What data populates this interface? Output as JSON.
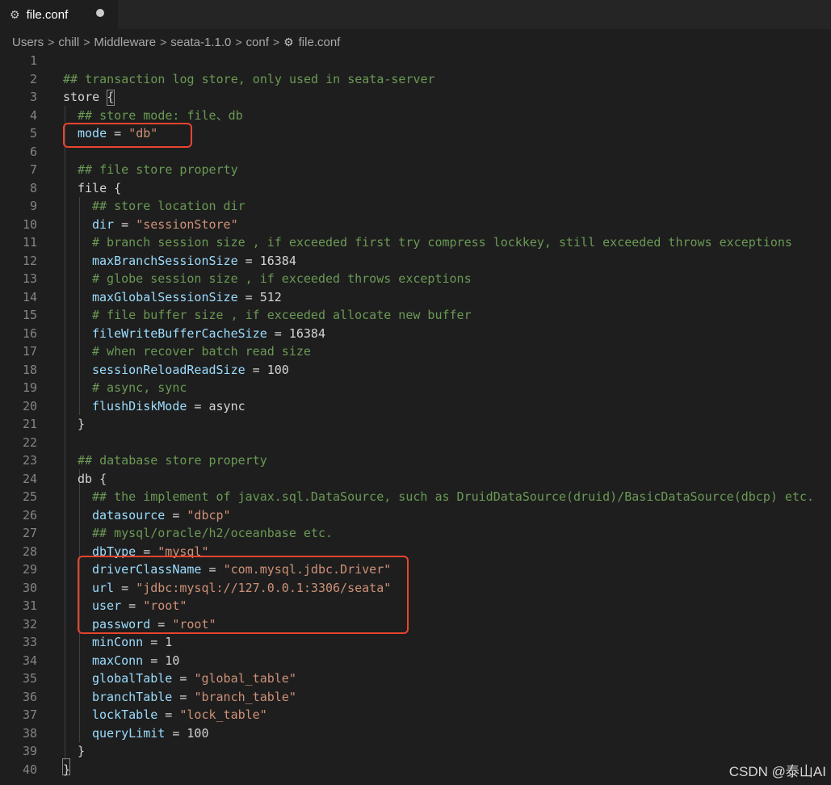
{
  "tab": {
    "title": "file.conf",
    "icon": "gear-icon",
    "modified": true
  },
  "breadcrumb": [
    "Users",
    "chill",
    "Middleware",
    "seata-1.1.0",
    "conf",
    "file.conf"
  ],
  "watermark": "CSDN @泰山AI",
  "colors": {
    "highlight": "#e8442e",
    "comment": "#6a9955",
    "key": "#9cdcfe",
    "string": "#ce9178"
  },
  "lines": [
    {
      "n": "1",
      "indent": 0,
      "tokens": []
    },
    {
      "n": "2",
      "indent": 0,
      "tokens": [
        {
          "t": "## transaction log store, only used in seata-server",
          "c": "comment"
        }
      ]
    },
    {
      "n": "3",
      "indent": 0,
      "tokens": [
        {
          "t": "store ",
          "c": "plain"
        },
        {
          "t": "{",
          "c": "plain"
        }
      ]
    },
    {
      "n": "4",
      "indent": 1,
      "tokens": [
        {
          "t": "## store mode: file、db",
          "c": "comment"
        }
      ]
    },
    {
      "n": "5",
      "indent": 1,
      "tokens": [
        {
          "t": "mode",
          "c": "key"
        },
        {
          "t": " = ",
          "c": "plain"
        },
        {
          "t": "\"db\"",
          "c": "str"
        }
      ]
    },
    {
      "n": "6",
      "indent": 0,
      "tokens": []
    },
    {
      "n": "7",
      "indent": 1,
      "tokens": [
        {
          "t": "## file store property",
          "c": "comment"
        }
      ]
    },
    {
      "n": "8",
      "indent": 1,
      "tokens": [
        {
          "t": "file {",
          "c": "plain"
        }
      ]
    },
    {
      "n": "9",
      "indent": 2,
      "tokens": [
        {
          "t": "## store location dir",
          "c": "comment"
        }
      ]
    },
    {
      "n": "10",
      "indent": 2,
      "tokens": [
        {
          "t": "dir",
          "c": "key"
        },
        {
          "t": " = ",
          "c": "plain"
        },
        {
          "t": "\"sessionStore\"",
          "c": "str"
        }
      ]
    },
    {
      "n": "11",
      "indent": 2,
      "tokens": [
        {
          "t": "# branch session size , if exceeded first try compress lockkey, still exceeded throws exceptions",
          "c": "comment"
        }
      ]
    },
    {
      "n": "12",
      "indent": 2,
      "tokens": [
        {
          "t": "maxBranchSessionSize",
          "c": "key"
        },
        {
          "t": " = 16384",
          "c": "plain"
        }
      ]
    },
    {
      "n": "13",
      "indent": 2,
      "tokens": [
        {
          "t": "# globe session size , if exceeded throws exceptions",
          "c": "comment"
        }
      ]
    },
    {
      "n": "14",
      "indent": 2,
      "tokens": [
        {
          "t": "maxGlobalSessionSize",
          "c": "key"
        },
        {
          "t": " = 512",
          "c": "plain"
        }
      ]
    },
    {
      "n": "15",
      "indent": 2,
      "tokens": [
        {
          "t": "# file buffer size , if exceeded allocate new buffer",
          "c": "comment"
        }
      ]
    },
    {
      "n": "16",
      "indent": 2,
      "tokens": [
        {
          "t": "fileWriteBufferCacheSize",
          "c": "key"
        },
        {
          "t": " = 16384",
          "c": "plain"
        }
      ]
    },
    {
      "n": "17",
      "indent": 2,
      "tokens": [
        {
          "t": "# when recover batch read size",
          "c": "comment"
        }
      ]
    },
    {
      "n": "18",
      "indent": 2,
      "tokens": [
        {
          "t": "sessionReloadReadSize",
          "c": "key"
        },
        {
          "t": " = 100",
          "c": "plain"
        }
      ]
    },
    {
      "n": "19",
      "indent": 2,
      "tokens": [
        {
          "t": "# async, sync",
          "c": "comment"
        }
      ]
    },
    {
      "n": "20",
      "indent": 2,
      "tokens": [
        {
          "t": "flushDiskMode",
          "c": "key"
        },
        {
          "t": " = async",
          "c": "plain"
        }
      ]
    },
    {
      "n": "21",
      "indent": 1,
      "tokens": [
        {
          "t": "}",
          "c": "plain"
        }
      ]
    },
    {
      "n": "22",
      "indent": 0,
      "tokens": []
    },
    {
      "n": "23",
      "indent": 1,
      "tokens": [
        {
          "t": "## database store property",
          "c": "comment"
        }
      ]
    },
    {
      "n": "24",
      "indent": 1,
      "tokens": [
        {
          "t": "db {",
          "c": "plain"
        }
      ]
    },
    {
      "n": "25",
      "indent": 2,
      "tokens": [
        {
          "t": "## the implement of javax.sql.DataSource, such as DruidDataSource(druid)/BasicDataSource(dbcp) etc.",
          "c": "comment"
        }
      ]
    },
    {
      "n": "26",
      "indent": 2,
      "tokens": [
        {
          "t": "datasource",
          "c": "key"
        },
        {
          "t": " = ",
          "c": "plain"
        },
        {
          "t": "\"dbcp\"",
          "c": "str"
        }
      ]
    },
    {
      "n": "27",
      "indent": 2,
      "tokens": [
        {
          "t": "## mysql/oracle/h2/oceanbase etc.",
          "c": "comment"
        }
      ]
    },
    {
      "n": "28",
      "indent": 2,
      "tokens": [
        {
          "t": "dbType",
          "c": "key"
        },
        {
          "t": " = ",
          "c": "plain"
        },
        {
          "t": "\"mysql\"",
          "c": "str"
        }
      ]
    },
    {
      "n": "29",
      "indent": 2,
      "tokens": [
        {
          "t": "driverClassName",
          "c": "key"
        },
        {
          "t": " = ",
          "c": "plain"
        },
        {
          "t": "\"com.mysql.jdbc.Driver\"",
          "c": "str"
        }
      ]
    },
    {
      "n": "30",
      "indent": 2,
      "tokens": [
        {
          "t": "url",
          "c": "key"
        },
        {
          "t": " = ",
          "c": "plain"
        },
        {
          "t": "\"jdbc:mysql://127.0.0.1:3306/seata\"",
          "c": "str"
        }
      ]
    },
    {
      "n": "31",
      "indent": 2,
      "tokens": [
        {
          "t": "user",
          "c": "key"
        },
        {
          "t": " = ",
          "c": "plain"
        },
        {
          "t": "\"root\"",
          "c": "str"
        }
      ]
    },
    {
      "n": "32",
      "indent": 2,
      "tokens": [
        {
          "t": "password",
          "c": "key"
        },
        {
          "t": " = ",
          "c": "plain"
        },
        {
          "t": "\"root\"",
          "c": "str"
        }
      ]
    },
    {
      "n": "33",
      "indent": 2,
      "tokens": [
        {
          "t": "minConn",
          "c": "key"
        },
        {
          "t": " = 1",
          "c": "plain"
        }
      ]
    },
    {
      "n": "34",
      "indent": 2,
      "tokens": [
        {
          "t": "maxConn",
          "c": "key"
        },
        {
          "t": " = 10",
          "c": "plain"
        }
      ]
    },
    {
      "n": "35",
      "indent": 2,
      "tokens": [
        {
          "t": "globalTable",
          "c": "key"
        },
        {
          "t": " = ",
          "c": "plain"
        },
        {
          "t": "\"global_table\"",
          "c": "str"
        }
      ]
    },
    {
      "n": "36",
      "indent": 2,
      "tokens": [
        {
          "t": "branchTable",
          "c": "key"
        },
        {
          "t": " = ",
          "c": "plain"
        },
        {
          "t": "\"branch_table\"",
          "c": "str"
        }
      ]
    },
    {
      "n": "37",
      "indent": 2,
      "tokens": [
        {
          "t": "lockTable",
          "c": "key"
        },
        {
          "t": " = ",
          "c": "plain"
        },
        {
          "t": "\"lock_table\"",
          "c": "str"
        }
      ]
    },
    {
      "n": "38",
      "indent": 2,
      "tokens": [
        {
          "t": "queryLimit",
          "c": "key"
        },
        {
          "t": " = 100",
          "c": "plain"
        }
      ]
    },
    {
      "n": "39",
      "indent": 1,
      "tokens": [
        {
          "t": "}",
          "c": "plain"
        }
      ]
    },
    {
      "n": "40",
      "indent": 0,
      "tokens": [
        {
          "t": "}",
          "c": "plain"
        }
      ]
    }
  ]
}
